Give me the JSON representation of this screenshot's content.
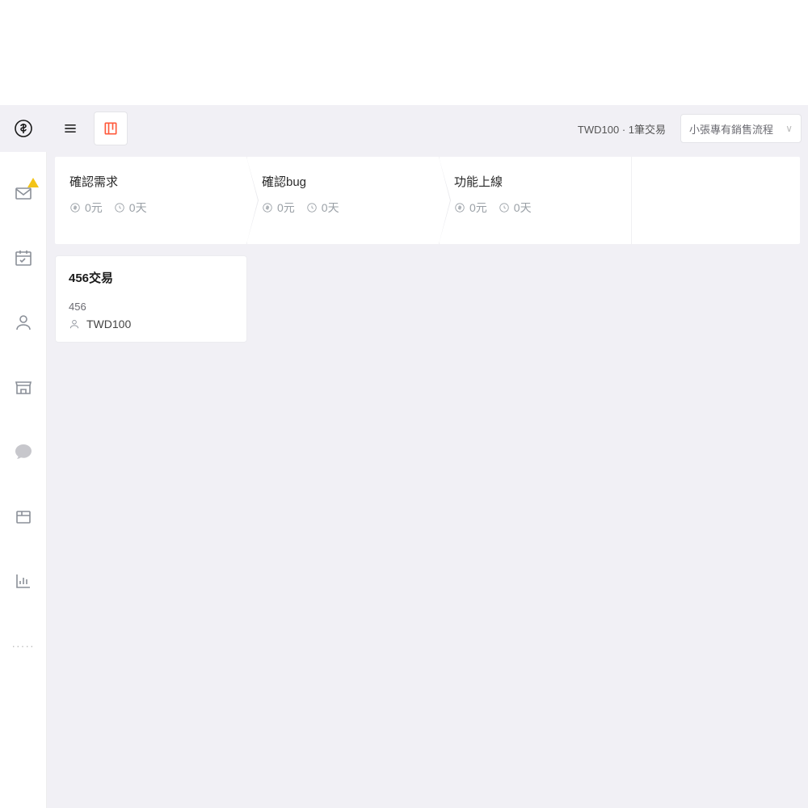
{
  "summary": "TWD100 · 1筆交易",
  "pipeline_select": "小張專有銷售流程",
  "stages": [
    {
      "title": "確認需求",
      "money": "0元",
      "days": "0天"
    },
    {
      "title": "確認bug",
      "money": "0元",
      "days": "0天"
    },
    {
      "title": "功能上線",
      "money": "0元",
      "days": "0天"
    }
  ],
  "deal": {
    "title": "456交易",
    "contact": "456",
    "amount": "TWD100"
  }
}
